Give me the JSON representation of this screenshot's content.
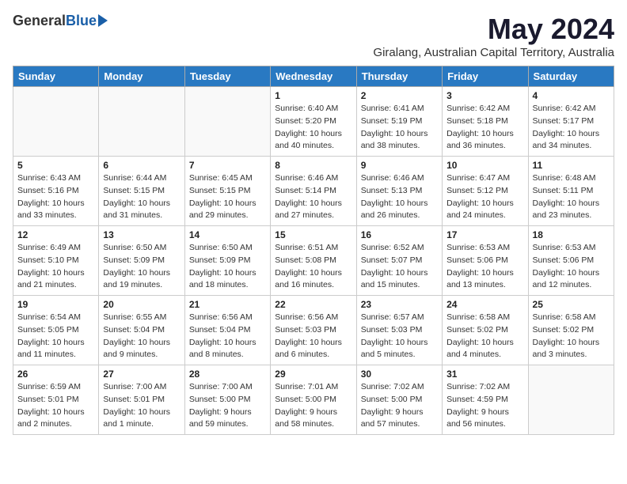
{
  "header": {
    "logo_general": "General",
    "logo_blue": "Blue",
    "month_title": "May 2024",
    "subtitle": "Giralang, Australian Capital Territory, Australia"
  },
  "days_of_week": [
    "Sunday",
    "Monday",
    "Tuesday",
    "Wednesday",
    "Thursday",
    "Friday",
    "Saturday"
  ],
  "weeks": [
    [
      {
        "num": "",
        "info": ""
      },
      {
        "num": "",
        "info": ""
      },
      {
        "num": "",
        "info": ""
      },
      {
        "num": "1",
        "info": "Sunrise: 6:40 AM\nSunset: 5:20 PM\nDaylight: 10 hours\nand 40 minutes."
      },
      {
        "num": "2",
        "info": "Sunrise: 6:41 AM\nSunset: 5:19 PM\nDaylight: 10 hours\nand 38 minutes."
      },
      {
        "num": "3",
        "info": "Sunrise: 6:42 AM\nSunset: 5:18 PM\nDaylight: 10 hours\nand 36 minutes."
      },
      {
        "num": "4",
        "info": "Sunrise: 6:42 AM\nSunset: 5:17 PM\nDaylight: 10 hours\nand 34 minutes."
      }
    ],
    [
      {
        "num": "5",
        "info": "Sunrise: 6:43 AM\nSunset: 5:16 PM\nDaylight: 10 hours\nand 33 minutes."
      },
      {
        "num": "6",
        "info": "Sunrise: 6:44 AM\nSunset: 5:15 PM\nDaylight: 10 hours\nand 31 minutes."
      },
      {
        "num": "7",
        "info": "Sunrise: 6:45 AM\nSunset: 5:15 PM\nDaylight: 10 hours\nand 29 minutes."
      },
      {
        "num": "8",
        "info": "Sunrise: 6:46 AM\nSunset: 5:14 PM\nDaylight: 10 hours\nand 27 minutes."
      },
      {
        "num": "9",
        "info": "Sunrise: 6:46 AM\nSunset: 5:13 PM\nDaylight: 10 hours\nand 26 minutes."
      },
      {
        "num": "10",
        "info": "Sunrise: 6:47 AM\nSunset: 5:12 PM\nDaylight: 10 hours\nand 24 minutes."
      },
      {
        "num": "11",
        "info": "Sunrise: 6:48 AM\nSunset: 5:11 PM\nDaylight: 10 hours\nand 23 minutes."
      }
    ],
    [
      {
        "num": "12",
        "info": "Sunrise: 6:49 AM\nSunset: 5:10 PM\nDaylight: 10 hours\nand 21 minutes."
      },
      {
        "num": "13",
        "info": "Sunrise: 6:50 AM\nSunset: 5:09 PM\nDaylight: 10 hours\nand 19 minutes."
      },
      {
        "num": "14",
        "info": "Sunrise: 6:50 AM\nSunset: 5:09 PM\nDaylight: 10 hours\nand 18 minutes."
      },
      {
        "num": "15",
        "info": "Sunrise: 6:51 AM\nSunset: 5:08 PM\nDaylight: 10 hours\nand 16 minutes."
      },
      {
        "num": "16",
        "info": "Sunrise: 6:52 AM\nSunset: 5:07 PM\nDaylight: 10 hours\nand 15 minutes."
      },
      {
        "num": "17",
        "info": "Sunrise: 6:53 AM\nSunset: 5:06 PM\nDaylight: 10 hours\nand 13 minutes."
      },
      {
        "num": "18",
        "info": "Sunrise: 6:53 AM\nSunset: 5:06 PM\nDaylight: 10 hours\nand 12 minutes."
      }
    ],
    [
      {
        "num": "19",
        "info": "Sunrise: 6:54 AM\nSunset: 5:05 PM\nDaylight: 10 hours\nand 11 minutes."
      },
      {
        "num": "20",
        "info": "Sunrise: 6:55 AM\nSunset: 5:04 PM\nDaylight: 10 hours\nand 9 minutes."
      },
      {
        "num": "21",
        "info": "Sunrise: 6:56 AM\nSunset: 5:04 PM\nDaylight: 10 hours\nand 8 minutes."
      },
      {
        "num": "22",
        "info": "Sunrise: 6:56 AM\nSunset: 5:03 PM\nDaylight: 10 hours\nand 6 minutes."
      },
      {
        "num": "23",
        "info": "Sunrise: 6:57 AM\nSunset: 5:03 PM\nDaylight: 10 hours\nand 5 minutes."
      },
      {
        "num": "24",
        "info": "Sunrise: 6:58 AM\nSunset: 5:02 PM\nDaylight: 10 hours\nand 4 minutes."
      },
      {
        "num": "25",
        "info": "Sunrise: 6:58 AM\nSunset: 5:02 PM\nDaylight: 10 hours\nand 3 minutes."
      }
    ],
    [
      {
        "num": "26",
        "info": "Sunrise: 6:59 AM\nSunset: 5:01 PM\nDaylight: 10 hours\nand 2 minutes."
      },
      {
        "num": "27",
        "info": "Sunrise: 7:00 AM\nSunset: 5:01 PM\nDaylight: 10 hours\nand 1 minute."
      },
      {
        "num": "28",
        "info": "Sunrise: 7:00 AM\nSunset: 5:00 PM\nDaylight: 9 hours\nand 59 minutes."
      },
      {
        "num": "29",
        "info": "Sunrise: 7:01 AM\nSunset: 5:00 PM\nDaylight: 9 hours\nand 58 minutes."
      },
      {
        "num": "30",
        "info": "Sunrise: 7:02 AM\nSunset: 5:00 PM\nDaylight: 9 hours\nand 57 minutes."
      },
      {
        "num": "31",
        "info": "Sunrise: 7:02 AM\nSunset: 4:59 PM\nDaylight: 9 hours\nand 56 minutes."
      },
      {
        "num": "",
        "info": ""
      }
    ]
  ]
}
